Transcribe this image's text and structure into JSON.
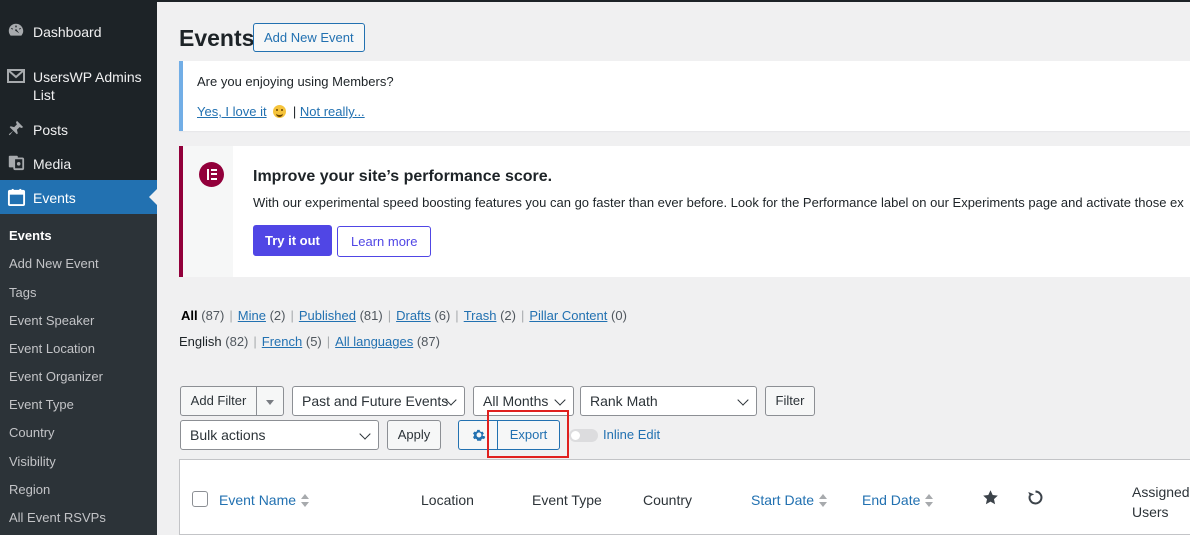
{
  "sidebar": {
    "items": [
      {
        "label": "Dashboard",
        "icon": "dashboard-icon"
      },
      {
        "label": "UsersWP Admins List",
        "icon": "mail-icon"
      },
      {
        "label": "Posts",
        "icon": "pin-icon"
      },
      {
        "label": "Media",
        "icon": "media-icon"
      },
      {
        "label": "Events",
        "icon": "calendar-icon",
        "active": true
      }
    ],
    "submenu": [
      "Events",
      "Add New Event",
      "Tags",
      "Event Speaker",
      "Event Location",
      "Event Organizer",
      "Event Type",
      "Country",
      "Visibility",
      "Region",
      "All Event RSVPs"
    ]
  },
  "header": {
    "title": "Events",
    "add_new_label": "Add New Event"
  },
  "members_notice": {
    "question": "Are you enjoying using Members?",
    "yes_label": "Yes, I love it",
    "sep": "|",
    "no_label": "Not really..."
  },
  "elementor_notice": {
    "title": "Improve your site’s performance score.",
    "description": "With our experimental speed boosting features you can go faster than ever before. Look for the Performance label on our Experiments page and activate those ex",
    "try_label": "Try it out",
    "learn_label": "Learn more"
  },
  "status_links": [
    {
      "label": "All",
      "count": "(87)",
      "current": true
    },
    {
      "label": "Mine",
      "count": "(2)"
    },
    {
      "label": "Published",
      "count": "(81)"
    },
    {
      "label": "Drafts",
      "count": "(6)"
    },
    {
      "label": "Trash",
      "count": "(2)"
    },
    {
      "label": "Pillar Content",
      "count": "(0)"
    }
  ],
  "language_links": [
    {
      "label": "English",
      "count": "(82)",
      "current": true
    },
    {
      "label": "French",
      "count": "(5)"
    },
    {
      "label": "All languages",
      "count": "(87)"
    }
  ],
  "filters": {
    "add_filter": "Add Filter",
    "event_range": "Past and Future Events",
    "months": "All Months",
    "seo": "Rank Math",
    "filter_button": "Filter",
    "bulk_actions": "Bulk actions",
    "apply": "Apply",
    "export": "Export",
    "inline_edit": "Inline Edit"
  },
  "table": {
    "columns": [
      "Event Name",
      "Location",
      "Event Type",
      "Country",
      "Start Date",
      "End Date",
      "Assigned Users"
    ]
  },
  "colors": {
    "accent": "#2271b1",
    "sidebar": "#1d2327",
    "elementor": "#92003b",
    "elementor_button": "#5046e5",
    "highlight": "#e0201f"
  }
}
